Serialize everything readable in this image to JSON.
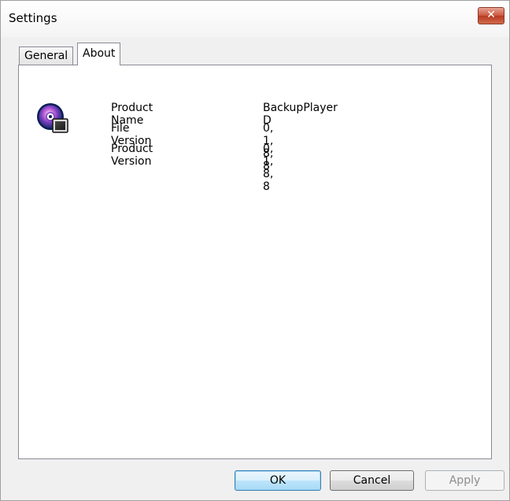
{
  "window": {
    "title": "Settings",
    "close_glyph": "✕"
  },
  "tabs": [
    {
      "label": "General",
      "selected": false
    },
    {
      "label": "About",
      "selected": true
    }
  ],
  "about": {
    "icon": "backup-player-disc-icon",
    "rows": [
      {
        "label": "Product Name",
        "value": "BackupPlayer D"
      },
      {
        "label": "File Version",
        "value": "0, 1, 8, 8"
      },
      {
        "label": "Product Version",
        "value": "0, 1, 8, 8"
      }
    ]
  },
  "buttons": {
    "ok": "OK",
    "cancel": "Cancel",
    "apply": "Apply"
  },
  "colors": {
    "close_button": "#c9553c",
    "default_button_border": "#3c7fb1"
  }
}
